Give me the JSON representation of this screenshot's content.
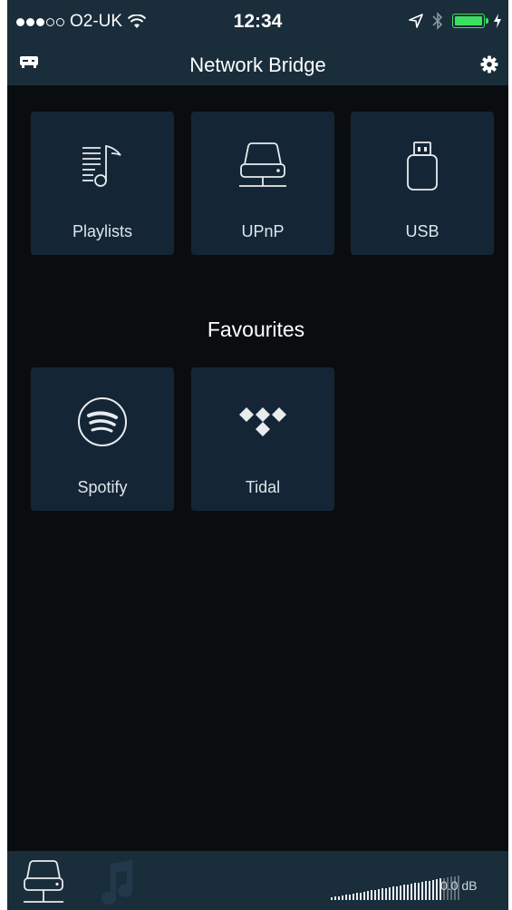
{
  "status_bar": {
    "carrier": "O2-UK",
    "time": "12:34",
    "signal_bars_filled": 3,
    "signal_bars_total": 5,
    "battery_color": "#3ce060"
  },
  "nav": {
    "title": "Network Bridge",
    "left_icon": "device-icon",
    "right_icon": "gear-icon"
  },
  "sources": [
    {
      "label": "Playlists",
      "icon": "playlist-icon"
    },
    {
      "label": "UPnP",
      "icon": "server-icon"
    },
    {
      "label": "USB",
      "icon": "usb-icon"
    }
  ],
  "favourites": {
    "heading": "Favourites",
    "items": [
      {
        "label": "Spotify",
        "icon": "spotify-icon"
      },
      {
        "label": "Tidal",
        "icon": "tidal-icon"
      }
    ]
  },
  "bottom_bar": {
    "volume_level": 0.85,
    "volume_text": "0.0 dB"
  },
  "colors": {
    "background": "#0a0d10",
    "bar": "#1a2d3b",
    "tile": "#142636"
  }
}
